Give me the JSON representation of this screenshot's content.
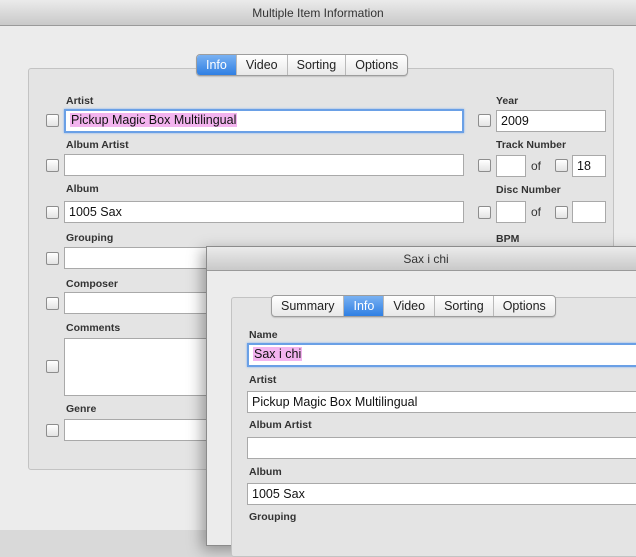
{
  "back_window": {
    "title": "Multiple Item Information",
    "tabs": [
      "Info",
      "Video",
      "Sorting",
      "Options"
    ],
    "active_tab": "Info",
    "fields": {
      "artist": {
        "label": "Artist",
        "value": "Pickup Magic Box Multilingual"
      },
      "album_artist": {
        "label": "Album Artist",
        "value": ""
      },
      "album": {
        "label": "Album",
        "value": "1005 Sax"
      },
      "grouping": {
        "label": "Grouping",
        "value": ""
      },
      "composer": {
        "label": "Composer",
        "value": ""
      },
      "comments": {
        "label": "Comments",
        "value": ""
      },
      "genre": {
        "label": "Genre",
        "value": ""
      },
      "year": {
        "label": "Year",
        "value": "2009"
      },
      "track_number": {
        "label": "Track Number",
        "value": "",
        "of": "of",
        "total": "18"
      },
      "disc_number": {
        "label": "Disc Number",
        "value": "",
        "of": "of",
        "total": ""
      },
      "bpm": {
        "label": "BPM"
      }
    }
  },
  "front_window": {
    "title": "Sax i chi",
    "tabs": [
      "Summary",
      "Info",
      "Video",
      "Sorting",
      "Options"
    ],
    "active_tab": "Info",
    "fields": {
      "name": {
        "label": "Name",
        "value": "Sax i chi"
      },
      "artist": {
        "label": "Artist",
        "value": "Pickup Magic Box Multilingual"
      },
      "album_artist": {
        "label": "Album Artist",
        "value": ""
      },
      "album": {
        "label": "Album",
        "value": "1005 Sax"
      },
      "grouping": {
        "label": "Grouping"
      }
    }
  },
  "colors": {
    "active_tab": "#2f7fe3",
    "focus_ring": "#6aa0e6",
    "text_selection": "#f3b4ef",
    "window_background": "#ececec"
  }
}
